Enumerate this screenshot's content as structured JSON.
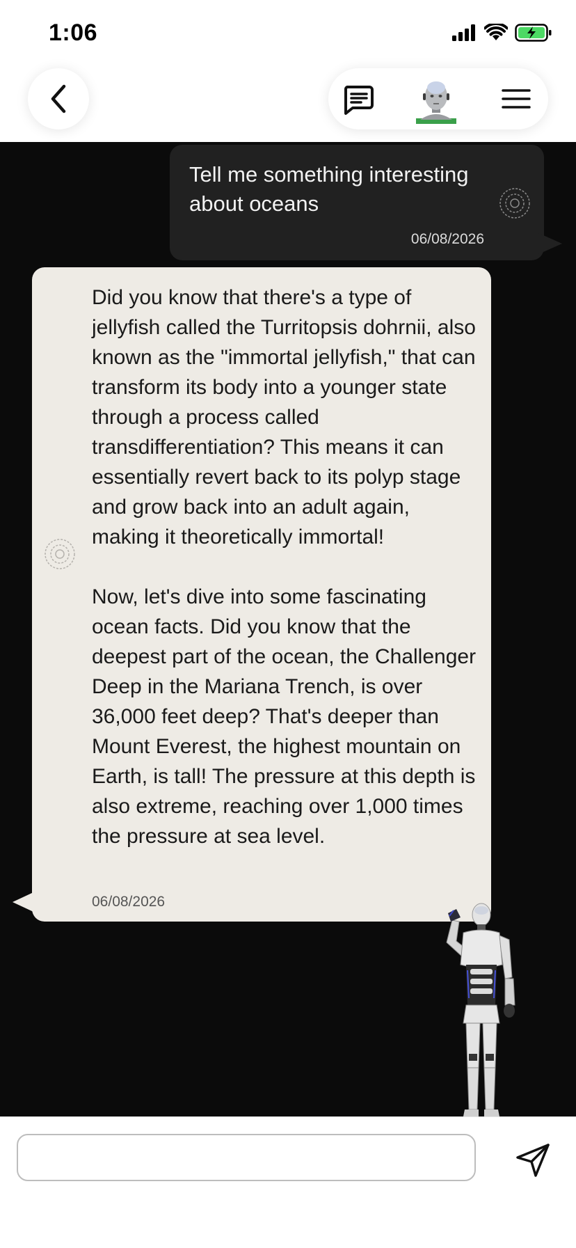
{
  "status_bar": {
    "time": "1:06",
    "battery_color": "#4CD964"
  },
  "header": {
    "back_icon": "chevron-left-icon",
    "chat_icon": "message-square-icon",
    "avatar_icon": "robot-avatar",
    "menu_icon": "hamburger-menu-icon"
  },
  "messages": [
    {
      "role": "user",
      "text": "Tell me something interesting about oceans",
      "timestamp": "06/08/2026"
    },
    {
      "role": "assistant",
      "text": "Did you know that there's a type of jellyfish called the Turritopsis dohrnii, also known as the \"immortal jellyfish,\" that can transform its body into a younger state through a process called transdifferentiation? This means it can essentially revert back to its polyp stage and grow back into an adult again, making it theoretically immortal!\n\nNow, let's dive into some fascinating ocean facts. Did you know that the deepest part of the ocean, the Challenger Deep in the Mariana Trench, is over 36,000 feet deep? That's deeper than Mount Everest, the highest mountain on Earth, is tall! The pressure at this depth is also extreme, reaching over 1,000 times the pressure at sea level.",
      "timestamp": "06/08/2026"
    }
  ],
  "input": {
    "placeholder": "",
    "value": ""
  },
  "colors": {
    "chat_background": "#0b0b0b",
    "user_bubble": "#212121",
    "assistant_bubble": "#eeebe5"
  }
}
